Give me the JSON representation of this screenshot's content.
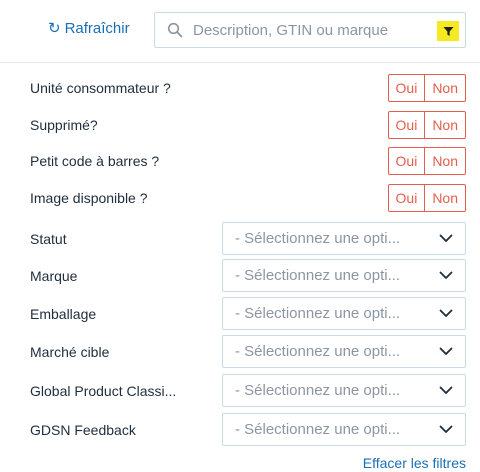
{
  "toolbar": {
    "refresh_label": "Rafraîchir",
    "search_placeholder": "Description, GTIN ou marque",
    "filter_button_color": "#f5ea22"
  },
  "toggles": [
    {
      "label": "Unité consommateur ?",
      "yes": "Oui",
      "no": "Non"
    },
    {
      "label": "Supprimé?",
      "yes": "Oui",
      "no": "Non"
    },
    {
      "label": "Petit code à barres ?",
      "yes": "Oui",
      "no": "Non"
    },
    {
      "label": "Image disponible ?",
      "yes": "Oui",
      "no": "Non"
    }
  ],
  "selects": [
    {
      "label": "Statut",
      "placeholder": "- Sélectionnez une opti..."
    },
    {
      "label": "Marque",
      "placeholder": "- Sélectionnez une opti..."
    },
    {
      "label": "Emballage",
      "placeholder": "- Sélectionnez une opti..."
    },
    {
      "label": "Marché cible",
      "placeholder": "- Sélectionnez une opti..."
    },
    {
      "label": "Global Product Classi...",
      "placeholder": "- Sélectionnez une opti..."
    },
    {
      "label": "GDSN Feedback",
      "placeholder": "- Sélectionnez une opti..."
    }
  ],
  "footer": {
    "clear_filters_label": "Effacer les filtres"
  },
  "colors": {
    "accent_blue": "#1a6fb5",
    "toggle_red": "#e35f4c",
    "border": "#cbd9ea"
  }
}
